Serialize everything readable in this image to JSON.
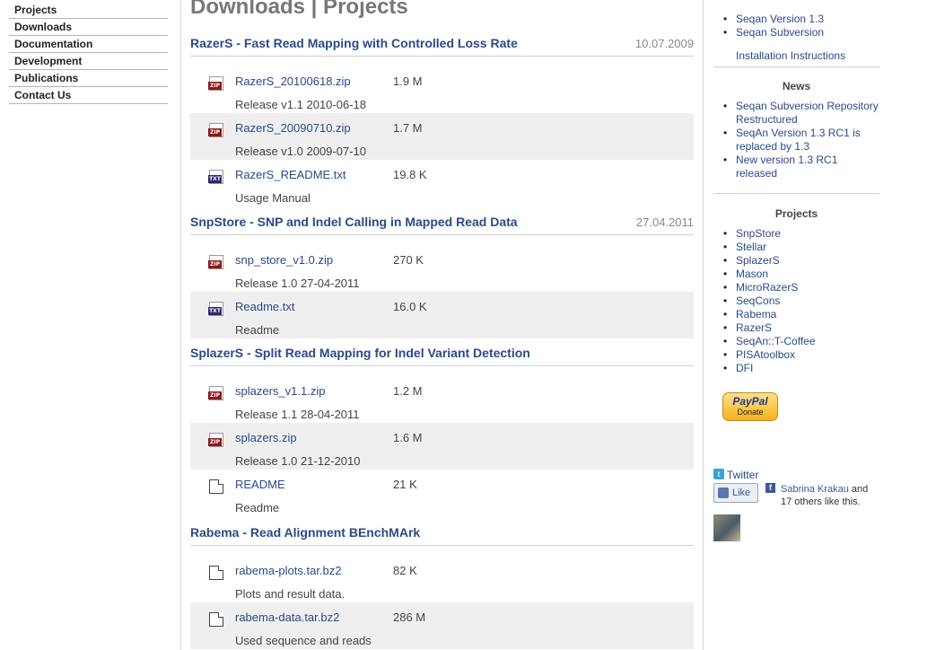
{
  "left_nav": [
    "Projects",
    "Downloads",
    "Documentation",
    "Development",
    "Publications",
    "Contact Us"
  ],
  "page_title": "Downloads | Projects",
  "sections": [
    {
      "title": "RazerS - Fast Read Mapping with Controlled Loss Rate",
      "date": "10.07.2009",
      "files": [
        {
          "icon": "zip-file-icon",
          "name": "RazerS_20100618.zip",
          "size": "1.9 M",
          "desc": "Release v1.1 2010-06-18"
        },
        {
          "icon": "zip-file-icon",
          "name": "RazerS_20090710.zip",
          "size": "1.7 M",
          "desc": "Release v1.0 2009-07-10"
        },
        {
          "icon": "txt-file-icon",
          "name": "RazerS_README.txt",
          "size": "19.8 K",
          "desc": "Usage Manual"
        }
      ]
    },
    {
      "title": "SnpStore - SNP and Indel Calling in Mapped Read Data",
      "date": "27.04.2011",
      "files": [
        {
          "icon": "zip-file-icon",
          "name": "snp_store_v1.0.zip",
          "size": "270 K",
          "desc": "Release 1.0 27-04-2011"
        },
        {
          "icon": "txt-file-icon",
          "name": "Readme.txt",
          "size": "16.0 K",
          "desc": "Readme"
        }
      ]
    },
    {
      "title": "SplazerS - Split Read Mapping for Indel Variant Detection",
      "date": "",
      "files": [
        {
          "icon": "zip-file-icon",
          "name": "splazers_v1.1.zip",
          "size": "1.2 M",
          "desc": "Release 1.1 28-04-2011"
        },
        {
          "icon": "zip-file-icon",
          "name": "splazers.zip",
          "size": "1.6 M",
          "desc": "Release 1.0 21-12-2010"
        },
        {
          "icon": "plain-file-icon",
          "name": "README",
          "size": "21 K",
          "desc": "Readme"
        }
      ]
    },
    {
      "title": "Rabema - Read Alignment BEnchMArk",
      "date": "",
      "files": [
        {
          "icon": "plain-file-icon",
          "name": "rabema-plots.tar.bz2",
          "size": "82 K",
          "desc": "Plots and result data."
        },
        {
          "icon": "plain-file-icon",
          "name": "rabema-data.tar.bz2",
          "size": "286 M",
          "desc": "Used sequence and reads"
        }
      ]
    }
  ],
  "sidebar": {
    "downloads_items": [
      "Seqan Version 1.3",
      "Seqan Subversion"
    ],
    "installation_link": "Installation Instructions",
    "news_heading": "News",
    "news_items": [
      "Seqan Subversion Repository Restructured",
      "SeqAn Version 1.3 RC1 is replaced by 1.3",
      "New version 1.3 RC1 released"
    ],
    "projects_heading": "Projects",
    "projects_items": [
      "SnpStore",
      "Stellar",
      "SplazerS",
      "Mason",
      "MicroRazerS",
      "SeqCons",
      "Rabema",
      "RazerS",
      "SeqAn::T-Coffee",
      "PISAtoolbox",
      "DFI"
    ],
    "paypal_word": "PayPal",
    "paypal_donate": "Donate",
    "twitter_label": "Twitter",
    "like_label": "Like",
    "fb_name": "Sabrina Krakau",
    "fb_rest": " and 17 others like this."
  }
}
